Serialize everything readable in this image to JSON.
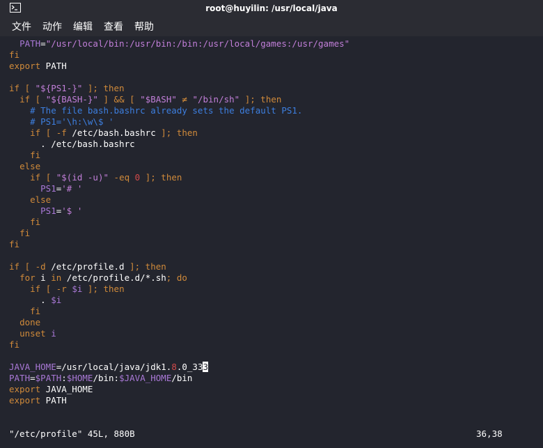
{
  "window": {
    "title": "root@huyilin: /usr/local/java",
    "icon": "terminal-icon"
  },
  "menu": [
    {
      "id": "file",
      "label": "文件"
    },
    {
      "id": "action",
      "label": "动作"
    },
    {
      "id": "edit",
      "label": "编辑"
    },
    {
      "id": "view",
      "label": "查看"
    },
    {
      "id": "help",
      "label": "帮助"
    }
  ],
  "colors": {
    "background": "#23252e",
    "default_text": "#ffffff",
    "keyword": "#d08a3a",
    "string": "#c27fd9",
    "variable": "#a978d6",
    "comment": "#3d7fe0",
    "number": "#d24a4a"
  },
  "editor": {
    "lines": [
      [
        {
          "t": "  "
        },
        {
          "t": "PATH",
          "c": "variable"
        },
        {
          "t": "="
        },
        {
          "t": "\"/usr/local/bin:/usr/bin:/bin:/usr/local/games:/usr/games\"",
          "c": "string"
        }
      ],
      [
        {
          "t": "fi",
          "c": "keyword"
        }
      ],
      [
        {
          "t": "export",
          "c": "keyword"
        },
        {
          "t": " PATH"
        }
      ],
      [],
      [
        {
          "t": "if",
          "c": "keyword"
        },
        {
          "t": " [ ",
          "c": "keyword"
        },
        {
          "t": "\"${PS1-}\"",
          "c": "string"
        },
        {
          "t": " ]; then",
          "c": "keyword"
        }
      ],
      [
        {
          "t": "  "
        },
        {
          "t": "if",
          "c": "keyword"
        },
        {
          "t": " [ ",
          "c": "keyword"
        },
        {
          "t": "\"${BASH-}\"",
          "c": "string"
        },
        {
          "t": " ] ",
          "c": "keyword"
        },
        {
          "t": "&&",
          "c": "keyword"
        },
        {
          "t": " [ ",
          "c": "keyword"
        },
        {
          "t": "\"$BASH\"",
          "c": "string"
        },
        {
          "t": " ≠ ",
          "c": "keyword"
        },
        {
          "t": "\"/bin/sh\"",
          "c": "string"
        },
        {
          "t": " ]; then",
          "c": "keyword"
        }
      ],
      [
        {
          "t": "    "
        },
        {
          "t": "# The file bash.bashrc already sets the default PS1.",
          "c": "comment"
        }
      ],
      [
        {
          "t": "    "
        },
        {
          "t": "# PS1='\\h:\\w\\$ '",
          "c": "comment"
        }
      ],
      [
        {
          "t": "    "
        },
        {
          "t": "if",
          "c": "keyword"
        },
        {
          "t": " [ -f ",
          "c": "keyword"
        },
        {
          "t": "/etc/bash.bashrc"
        },
        {
          "t": " ]; then",
          "c": "keyword"
        }
      ],
      [
        {
          "t": "      . /etc/bash.bashrc"
        }
      ],
      [
        {
          "t": "    "
        },
        {
          "t": "fi",
          "c": "keyword"
        }
      ],
      [
        {
          "t": "  "
        },
        {
          "t": "else",
          "c": "keyword"
        }
      ],
      [
        {
          "t": "    "
        },
        {
          "t": "if",
          "c": "keyword"
        },
        {
          "t": " [ ",
          "c": "keyword"
        },
        {
          "t": "\"$(id -u)\"",
          "c": "string"
        },
        {
          "t": " -eq ",
          "c": "keyword"
        },
        {
          "t": "0",
          "c": "number"
        },
        {
          "t": " ]; then",
          "c": "keyword"
        }
      ],
      [
        {
          "t": "      "
        },
        {
          "t": "PS1",
          "c": "variable"
        },
        {
          "t": "="
        },
        {
          "t": "'# '",
          "c": "string"
        }
      ],
      [
        {
          "t": "    "
        },
        {
          "t": "else",
          "c": "keyword"
        }
      ],
      [
        {
          "t": "      "
        },
        {
          "t": "PS1",
          "c": "variable"
        },
        {
          "t": "="
        },
        {
          "t": "'$ '",
          "c": "string"
        }
      ],
      [
        {
          "t": "    "
        },
        {
          "t": "fi",
          "c": "keyword"
        }
      ],
      [
        {
          "t": "  "
        },
        {
          "t": "fi",
          "c": "keyword"
        }
      ],
      [
        {
          "t": "fi",
          "c": "keyword"
        }
      ],
      [],
      [
        {
          "t": "if",
          "c": "keyword"
        },
        {
          "t": " [ -d ",
          "c": "keyword"
        },
        {
          "t": "/etc/profile.d"
        },
        {
          "t": " ]; then",
          "c": "keyword"
        }
      ],
      [
        {
          "t": "  "
        },
        {
          "t": "for",
          "c": "keyword"
        },
        {
          "t": " i "
        },
        {
          "t": "in",
          "c": "keyword"
        },
        {
          "t": " /etc/profile.d/*.sh"
        },
        {
          "t": "; do",
          "c": "keyword"
        }
      ],
      [
        {
          "t": "    "
        },
        {
          "t": "if",
          "c": "keyword"
        },
        {
          "t": " [ -r ",
          "c": "keyword"
        },
        {
          "t": "$i",
          "c": "variable"
        },
        {
          "t": " ]; then",
          "c": "keyword"
        }
      ],
      [
        {
          "t": "      . "
        },
        {
          "t": "$i",
          "c": "variable"
        }
      ],
      [
        {
          "t": "    "
        },
        {
          "t": "fi",
          "c": "keyword"
        }
      ],
      [
        {
          "t": "  "
        },
        {
          "t": "done",
          "c": "keyword"
        }
      ],
      [
        {
          "t": "  "
        },
        {
          "t": "unset",
          "c": "keyword"
        },
        {
          "t": " "
        },
        {
          "t": "i",
          "c": "variable"
        }
      ],
      [
        {
          "t": "fi",
          "c": "keyword"
        }
      ],
      [],
      [
        {
          "t": "JAVA_HOME",
          "c": "variable"
        },
        {
          "t": "=/usr/local/java/jdk1."
        },
        {
          "t": "8",
          "c": "number"
        },
        {
          "t": ".0_33"
        },
        {
          "t": "3",
          "cursor": true
        }
      ],
      [
        {
          "t": "PATH",
          "c": "variable"
        },
        {
          "t": "="
        },
        {
          "t": "$PATH",
          "c": "variable"
        },
        {
          "t": ":"
        },
        {
          "t": "$HOME",
          "c": "variable"
        },
        {
          "t": "/bin:"
        },
        {
          "t": "$JAVA_HOME",
          "c": "variable"
        },
        {
          "t": "/bin"
        }
      ],
      [
        {
          "t": "export",
          "c": "keyword"
        },
        {
          "t": " JAVA_HOME"
        }
      ],
      [
        {
          "t": "export",
          "c": "keyword"
        },
        {
          "t": " PATH"
        }
      ]
    ]
  },
  "status": {
    "file_info": "\"/etc/profile\" 45L, 880B",
    "position": "36,38"
  }
}
